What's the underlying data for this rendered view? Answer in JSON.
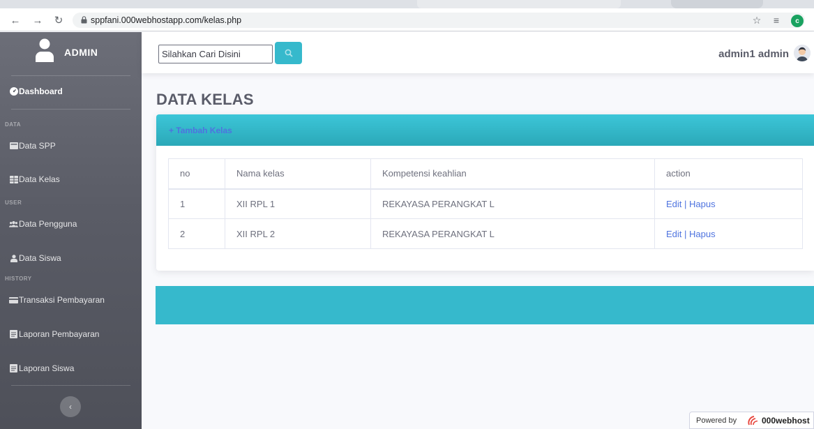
{
  "browser": {
    "url": "sppfani.000webhostapp.com/kelas.php",
    "profile_initial": "c"
  },
  "sidebar": {
    "brand": "ADMIN",
    "items": [
      {
        "label": "Dashboard",
        "icon": "tachometer-icon"
      },
      {
        "heading": "DATA"
      },
      {
        "label": "Data SPP",
        "icon": "card-icon"
      },
      {
        "label": "Data Kelas",
        "icon": "table-icon"
      },
      {
        "heading": "USER"
      },
      {
        "label": "Data Pengguna",
        "icon": "users-icon"
      },
      {
        "label": "Data Siswa",
        "icon": "user-icon"
      },
      {
        "heading": "HISTORY"
      },
      {
        "label": "Transaksi Pembayaran",
        "icon": "credit-card-icon"
      },
      {
        "label": "Laporan Pembayaran",
        "icon": "report-icon"
      },
      {
        "label": "Laporan Siswa",
        "icon": "report-icon"
      }
    ]
  },
  "topbar": {
    "search_placeholder": "Silahkan Cari Disini",
    "user_name": "admin1 admin"
  },
  "main": {
    "title": "DATA KELAS",
    "add_label": "+ Tambah Kelas",
    "table": {
      "columns": [
        "no",
        "Nama kelas",
        "Kompetensi keahlian",
        "action"
      ],
      "rows": [
        {
          "no": "1",
          "nama_kelas": "XII RPL 1",
          "kompetensi": "REKAYASA PERANGKAT L",
          "edit": "Edit",
          "sep": "|",
          "hapus": "Hapus"
        },
        {
          "no": "2",
          "nama_kelas": "XII RPL 2",
          "kompetensi": "REKAYASA PERANGKAT L",
          "edit": "Edit",
          "sep": "|",
          "hapus": "Hapus"
        }
      ]
    }
  },
  "footer": {
    "powered_by": "Powered by",
    "brand": "000webhost"
  },
  "colors": {
    "accent": "#36b9cc",
    "link": "#4e73df",
    "sidebar": "#5a5c66"
  }
}
